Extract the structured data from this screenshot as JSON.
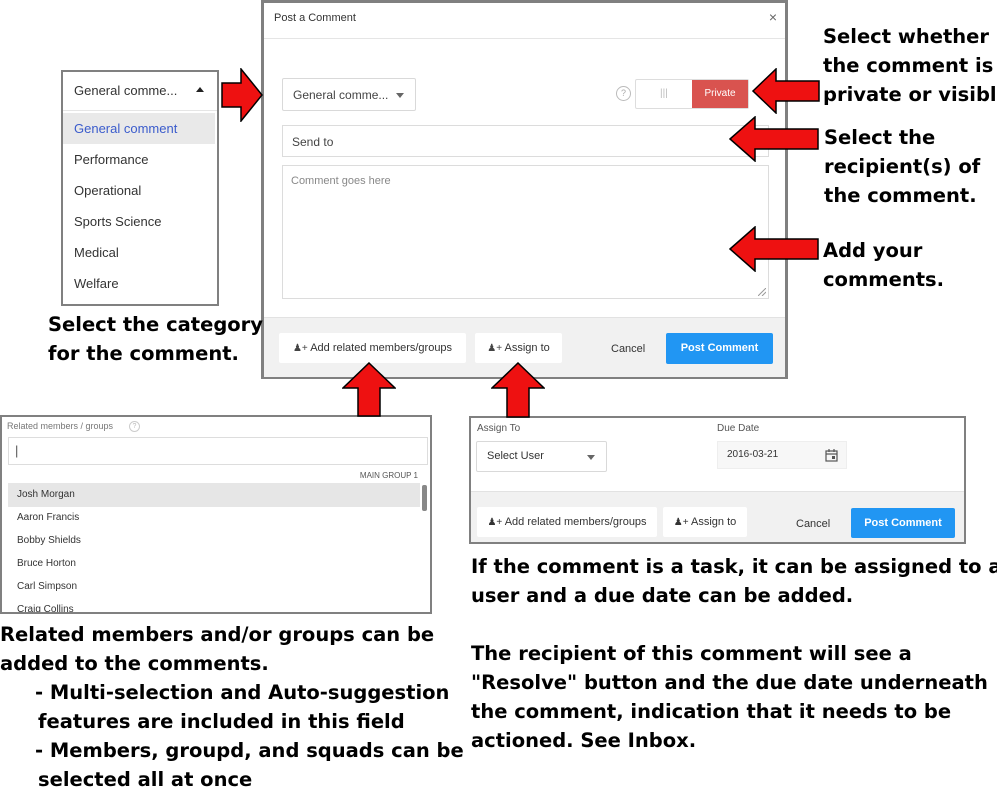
{
  "modal": {
    "title": "Post a Comment",
    "close_icon": "close-icon",
    "category_value": "General comme...",
    "help_icon": "help-icon",
    "toggle_left_glyph": "|||",
    "toggle_right_label": "Private",
    "send_to_placeholder": "Send to",
    "comment_placeholder": "Comment goes here",
    "add_related_label": "Add related members/groups",
    "assign_to_label": "Assign to",
    "cancel_label": "Cancel",
    "post_label": "Post Comment"
  },
  "category_dropdown": {
    "selected": "General comme...",
    "options": [
      "General comment",
      "Performance",
      "Operational",
      "Sports Science",
      "Medical",
      "Welfare"
    ]
  },
  "related_panel": {
    "label": "Related members / groups",
    "input_value": "|",
    "group_header": "MAIN GROUP 1",
    "members": [
      "Josh Morgan",
      "Aaron Francis",
      "Bobby Shields",
      "Bruce Horton",
      "Carl Simpson",
      "Craig Collins"
    ]
  },
  "assign_panel": {
    "assign_to_label": "Assign To",
    "user_select": "Select User",
    "due_date_label": "Due Date",
    "due_date_value": "2016-03-21",
    "add_related_label": "Add related members/groups",
    "assign_to_button": "Assign to",
    "cancel_label": "Cancel",
    "post_label": "Post Comment"
  },
  "annotations": {
    "private_visible": [
      "Select whether",
      "the comment is",
      "private or visible."
    ],
    "recipients": [
      "Select the",
      "recipient(s) of",
      "the comment."
    ],
    "add_comments": [
      "Add your",
      "comments."
    ],
    "category": [
      "Select the category",
      "for the comment."
    ],
    "related_members": [
      "Related members and/or groups can be",
      "added to the comments.",
      "- Multi-selection and Auto-suggestion",
      "features are included in this field",
      "- Members, groupd, and squads can be",
      "selected all at once"
    ],
    "task": [
      "If the comment is a task, it can be assigned to a",
      "user and a due date can be added."
    ],
    "resolve": [
      "The recipient of this comment will see a",
      "\"Resolve\" button and the due date underneath",
      "the comment, indication that it needs to be",
      "actioned.  See Inbox."
    ]
  },
  "colors": {
    "arrow_red": "#ee1111",
    "accent_blue": "#2196f3",
    "private_red": "#d9534f",
    "frame_gray": "#808080"
  }
}
